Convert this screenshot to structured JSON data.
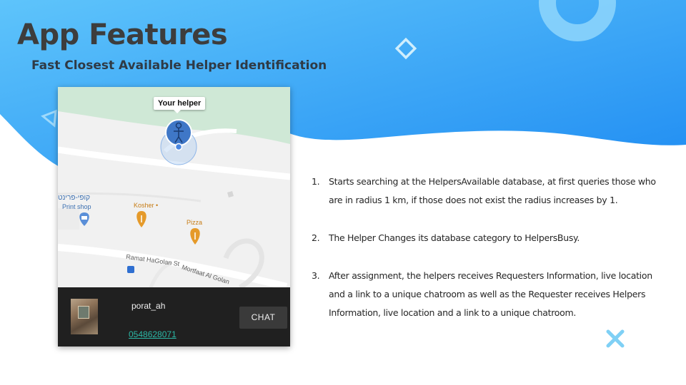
{
  "slide": {
    "title": "App Features",
    "subtitle": "Fast Closest Available Helper Identification"
  },
  "map": {
    "helper_tooltip": "Your helper",
    "place_hebrew": "קופי-פרינט",
    "place_print_shop": "Print shop",
    "place_kosher": "Kosher •",
    "place_pizza": "Pizza",
    "street_1": "Ramat HaGolan St",
    "street_2": "Mortfaat Al Golan"
  },
  "chat": {
    "username": "porat_ah",
    "phone": "0548628071",
    "button_label": "CHAT"
  },
  "features": [
    {
      "num": "1.",
      "text": "Starts searching at the HelpersAvailable database, at first queries those who are in radius 1 km, if those does not exist the radius increases by 1."
    },
    {
      "num": "2.",
      "text": "The Helper Changes its database category to HelpersBusy."
    },
    {
      "num": "3.",
      "text": "After assignment, the helpers receives Requesters Information, live location and a link to a unique chatroom as well as the Requester receives Helpers Information, live location and a link to a unique chatroom."
    }
  ],
  "colors": {
    "wave_light": "#5dc3fa",
    "wave_dark": "#1f8ff3",
    "accent_x": "#7fd0f5",
    "title": "#3d3d3d"
  }
}
